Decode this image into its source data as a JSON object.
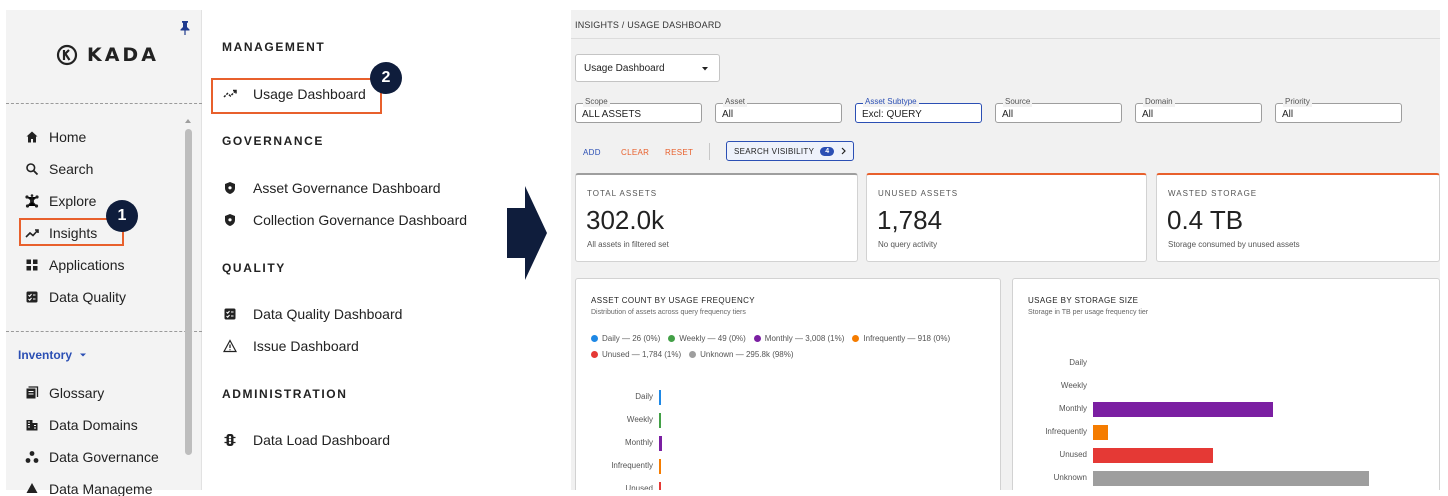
{
  "sidebar": {
    "brand": "KADA",
    "items": [
      {
        "label": "Home",
        "icon": "home-icon"
      },
      {
        "label": "Search",
        "icon": "search-icon"
      },
      {
        "label": "Explore",
        "icon": "explore-icon"
      },
      {
        "label": "Insights",
        "icon": "insights-icon"
      },
      {
        "label": "Applications",
        "icon": "applications-icon"
      },
      {
        "label": "Data Quality",
        "icon": "data-quality-icon"
      }
    ],
    "inventory_label": "Inventory",
    "inventory_items": [
      {
        "label": "Glossary",
        "icon": "glossary-icon"
      },
      {
        "label": "Data Domains",
        "icon": "data-domains-icon"
      },
      {
        "label": "Data Governance",
        "icon": "data-governance-icon"
      },
      {
        "label": "Data Manageme",
        "icon": "data-management-icon"
      }
    ]
  },
  "flyout": {
    "sections": [
      {
        "heading": "MANAGEMENT",
        "items": [
          {
            "label": "Usage Dashboard",
            "icon": "usage-trend-icon"
          }
        ]
      },
      {
        "heading": "GOVERNANCE",
        "items": [
          {
            "label": "Asset Governance Dashboard",
            "icon": "shield-icon"
          },
          {
            "label": "Collection Governance Dashboard",
            "icon": "shield-icon"
          }
        ]
      },
      {
        "heading": "QUALITY",
        "items": [
          {
            "label": "Data Quality Dashboard",
            "icon": "quality-check-icon"
          },
          {
            "label": "Issue Dashboard",
            "icon": "warning-icon"
          }
        ]
      },
      {
        "heading": "ADMINISTRATION",
        "items": [
          {
            "label": "Data Load Dashboard",
            "icon": "data-load-icon"
          }
        ]
      }
    ]
  },
  "callouts": [
    "1",
    "2"
  ],
  "colors": {
    "accent": "#e8602c",
    "navy": "#0f1d3c",
    "link": "#2b4fb4"
  },
  "dashboard": {
    "breadcrumb": "INSIGHTS / USAGE DASHBOARD",
    "view_select": "Usage Dashboard",
    "filters": [
      {
        "label": "Scope",
        "value": "ALL ASSETS"
      },
      {
        "label": "Asset",
        "value": "All"
      },
      {
        "label": "Asset Subtype",
        "value": "Excl: QUERY"
      },
      {
        "label": "Source",
        "value": "All"
      },
      {
        "label": "Domain",
        "value": "All"
      },
      {
        "label": "Priority",
        "value": "All"
      }
    ],
    "actions": {
      "add": "ADD",
      "clear": "CLEAR",
      "reset": "RESET",
      "search_visibility": "SEARCH VISIBILITY",
      "search_visibility_count": "4"
    },
    "kpis": [
      {
        "title": "TOTAL ASSETS",
        "value": "302.0k",
        "sub": "All assets in filtered set"
      },
      {
        "title": "UNUSED ASSETS",
        "value": "1,784",
        "sub": "No query activity"
      },
      {
        "title": "WASTED STORAGE",
        "value": "0.4 TB",
        "sub": "Storage consumed by unused assets"
      }
    ]
  },
  "chart_data": [
    {
      "type": "bar",
      "orientation": "horizontal",
      "title": "ASSET COUNT BY USAGE FREQUENCY",
      "subtitle": "Distribution of assets across query frequency tiers",
      "legend": [
        {
          "label": "Daily — 26 (0%)",
          "color": "#1e88e5"
        },
        {
          "label": "Weekly — 49 (0%)",
          "color": "#43a047"
        },
        {
          "label": "Monthly — 3,008 (1%)",
          "color": "#7b1fa2"
        },
        {
          "label": "Infrequently — 918 (0%)",
          "color": "#f57c00"
        },
        {
          "label": "Unused — 1,784 (1%)",
          "color": "#e53935"
        },
        {
          "label": "Unknown — 295.8k (98%)",
          "color": "#9e9e9e"
        }
      ],
      "categories": [
        "Daily",
        "Weekly",
        "Monthly",
        "Infrequently",
        "Unused"
      ],
      "values": [
        26,
        49,
        3008,
        918,
        1784
      ],
      "colors": [
        "#1e88e5",
        "#43a047",
        "#7b1fa2",
        "#f57c00",
        "#e53935"
      ],
      "xlim": [
        0,
        295800
      ]
    },
    {
      "type": "bar",
      "orientation": "horizontal",
      "title": "USAGE BY STORAGE SIZE",
      "subtitle": "Storage in TB per usage frequency tier",
      "categories": [
        "Daily",
        "Weekly",
        "Monthly",
        "Infrequently",
        "Unused",
        "Unknown"
      ],
      "values": [
        0,
        0,
        0.6,
        0.05,
        0.4,
        0.92
      ],
      "colors": [
        "#1e88e5",
        "#43a047",
        "#7b1fa2",
        "#f57c00",
        "#e53935",
        "#9e9e9e"
      ],
      "xlim": [
        0,
        1.0
      ]
    }
  ]
}
